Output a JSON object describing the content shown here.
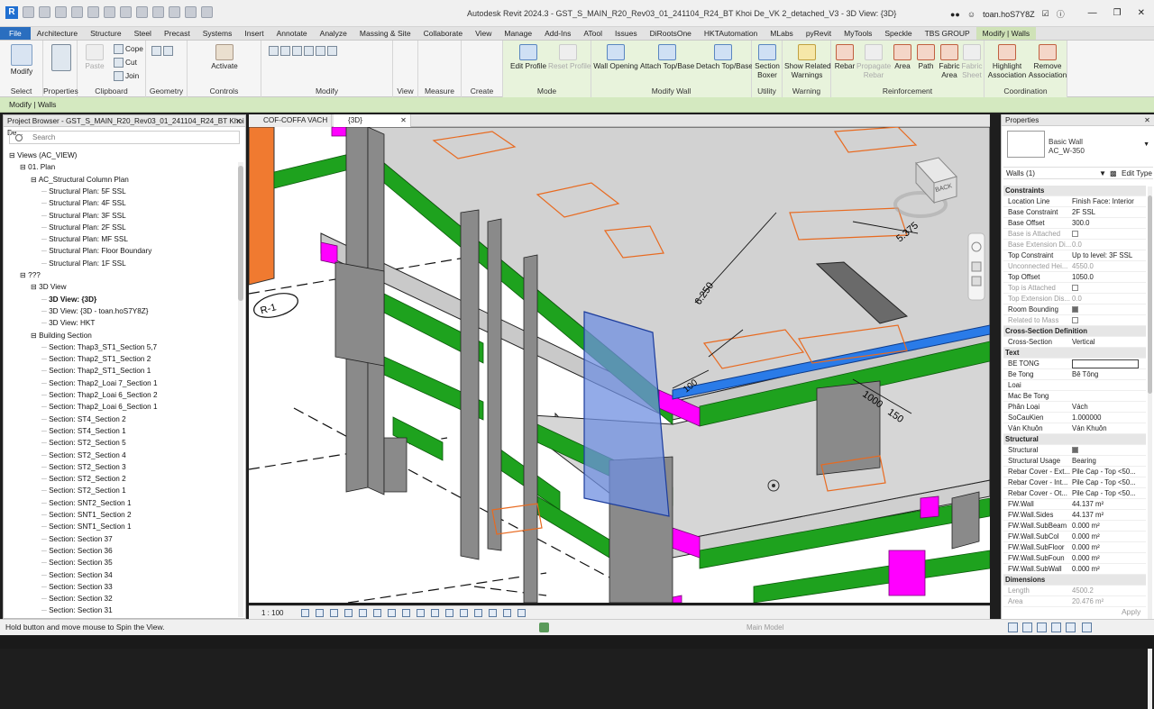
{
  "window": {
    "title": "Autodesk Revit 2024.3 - GST_S_MAIN_R20_Rev03_01_241104_R24_BT Khoi De_VK 2_detached_V3 - 3D View: {3D}",
    "user": "toan.hoS7Y8Z",
    "logo": "R"
  },
  "tabs": [
    "File",
    "Architecture",
    "Structure",
    "Steel",
    "Precast",
    "Systems",
    "Insert",
    "Annotate",
    "Analyze",
    "Massing & Site",
    "Collaborate",
    "View",
    "Manage",
    "Add-Ins",
    "ATool",
    "Issues",
    "DiRootsOne",
    "HKTAutomation",
    "MLabs",
    "pyRevit",
    "MyTools",
    "Speckle",
    "TBS GROUP",
    "Modify | Walls"
  ],
  "ribbon": {
    "select": {
      "modify": "Modify",
      "label": "Select"
    },
    "properties": {
      "label": "Properties"
    },
    "clipboard": {
      "paste": "Paste",
      "cope": "Cope",
      "cut": "Cut",
      "join": "Join",
      "label": "Clipboard"
    },
    "geometry": {
      "label": "Geometry"
    },
    "controls": {
      "activate": "Activate",
      "label": "Controls"
    },
    "modify": {
      "label": "Modify"
    },
    "view": {
      "label": "View"
    },
    "measure": {
      "label": "Measure"
    },
    "create": {
      "label": "Create"
    },
    "mode": {
      "edit_profile": "Edit Profile",
      "reset_profile": "Reset Profile",
      "label": "Mode"
    },
    "modify_wall": {
      "wall_opening": "Wall Opening",
      "attach": "Attach Top/Base",
      "detach": "Detach Top/Base",
      "label": "Modify Wall"
    },
    "utility": {
      "section_boxer_1": "Section",
      "section_boxer_2": "Boxer",
      "label": "Utility"
    },
    "warning": {
      "show_1": "Show Related",
      "show_2": "Warnings",
      "label": "Warning"
    },
    "reinforcement": {
      "rebar": "Rebar",
      "propagate_1": "Propagate",
      "propagate_2": "Rebar",
      "area": "Area",
      "path": "Path",
      "fabric_1": "Fabric",
      "fabric_2": "Area",
      "fabric_sheet_1": "Fabric",
      "fabric_sheet_2": "Sheet",
      "label": "Reinforcement"
    },
    "coordination": {
      "highlight_1": "Highlight",
      "highlight_2": "Association",
      "remove_1": "Remove",
      "remove_2": "Association",
      "label": "Coordination"
    }
  },
  "context": "Modify | Walls",
  "project_browser": {
    "title": "Project Browser - GST_S_MAIN_R20_Rev03_01_241104_R24_BT Khoi De...",
    "search_placeholder": "Search",
    "items": [
      {
        "text": "Views (AC_VIEW)",
        "level": 0,
        "exp": "-"
      },
      {
        "text": "01. Plan",
        "level": 1,
        "exp": "-"
      },
      {
        "text": "AC_Structural Column Plan",
        "level": 2,
        "exp": "-"
      },
      {
        "text": "Structural Plan: 5F SSL",
        "level": 3
      },
      {
        "text": "Structural Plan: 4F SSL",
        "level": 3
      },
      {
        "text": "Structural Plan: 3F SSL",
        "level": 3
      },
      {
        "text": "Structural Plan: 2F SSL",
        "level": 3
      },
      {
        "text": "Structural Plan: MF SSL",
        "level": 3
      },
      {
        "text": "Structural Plan: Floor Boundary",
        "level": 3
      },
      {
        "text": "Structural Plan: 1F SSL",
        "level": 3
      },
      {
        "text": "???",
        "level": 1,
        "exp": "-"
      },
      {
        "text": "3D View",
        "level": 2,
        "exp": "-"
      },
      {
        "text": "3D View: {3D}",
        "level": 3,
        "bold": true
      },
      {
        "text": "3D View: {3D - toan.hoS7Y8Z}",
        "level": 3
      },
      {
        "text": "3D View: HKT",
        "level": 3
      },
      {
        "text": "Building Section",
        "level": 2,
        "exp": "-"
      },
      {
        "text": "Section: Thap3_ST1_Section 5,7",
        "level": 3
      },
      {
        "text": "Section: Thap2_ST1_Section 2",
        "level": 3
      },
      {
        "text": "Section: Thap2_ST1_Section 1",
        "level": 3
      },
      {
        "text": "Section: Thap2_Loai 7_Section 1",
        "level": 3
      },
      {
        "text": "Section: Thap2_Loai 6_Section 2",
        "level": 3
      },
      {
        "text": "Section: Thap2_Loai 6_Section 1",
        "level": 3
      },
      {
        "text": "Section: ST4_Section 2",
        "level": 3
      },
      {
        "text": "Section: ST4_Section 1",
        "level": 3
      },
      {
        "text": "Section: ST2_Section 5",
        "level": 3
      },
      {
        "text": "Section: ST2_Section 4",
        "level": 3
      },
      {
        "text": "Section: ST2_Section 3",
        "level": 3
      },
      {
        "text": "Section: ST2_Section 2",
        "level": 3
      },
      {
        "text": "Section: ST2_Section 1",
        "level": 3
      },
      {
        "text": "Section: SNT2_Section 1",
        "level": 3
      },
      {
        "text": "Section: SNT1_Section 2",
        "level": 3
      },
      {
        "text": "Section: SNT1_Section 1",
        "level": 3
      },
      {
        "text": "Section: Section 37",
        "level": 3
      },
      {
        "text": "Section: Section 36",
        "level": 3
      },
      {
        "text": "Section: Section 35",
        "level": 3
      },
      {
        "text": "Section: Section 34",
        "level": 3
      },
      {
        "text": "Section: Section 33",
        "level": 3
      },
      {
        "text": "Section: Section 32",
        "level": 3
      },
      {
        "text": "Section: Section 31",
        "level": 3
      }
    ]
  },
  "view_tabs": [
    {
      "label": "COF-COFFA VACH"
    },
    {
      "label": "{3D}"
    }
  ],
  "canvas": {
    "dims": [
      "5.375",
      "6.250",
      "1000",
      "150",
      "100"
    ],
    "grid_bubble": "R-1",
    "viewcube_face": "BACK"
  },
  "view_control": {
    "scale": "1 : 100"
  },
  "properties": {
    "title": "Properties",
    "type_name": "Basic Wall",
    "type_sub": "AC_W-350",
    "instance": "Walls (1)",
    "edit_type": "Edit Type",
    "rows": [
      {
        "cat": "Constraints"
      },
      {
        "k": "Location Line",
        "v": "Finish Face: Interior"
      },
      {
        "k": "Base Constraint",
        "v": "2F SSL"
      },
      {
        "k": "Base Offset",
        "v": "300.0"
      },
      {
        "k": "Base is Attached",
        "v": "",
        "cb": "off",
        "dim": true
      },
      {
        "k": "Base Extension Di...",
        "v": "0.0",
        "dim": true
      },
      {
        "k": "Top Constraint",
        "v": "Up to level: 3F SSL"
      },
      {
        "k": "Unconnected Hei...",
        "v": "4550.0",
        "dim": true
      },
      {
        "k": "Top Offset",
        "v": "1050.0"
      },
      {
        "k": "Top is Attached",
        "v": "",
        "cb": "off",
        "dim": true
      },
      {
        "k": "Top Extension Dis...",
        "v": "0.0",
        "dim": true
      },
      {
        "k": "Room Bounding",
        "v": "",
        "cb": "on"
      },
      {
        "k": "Related to Mass",
        "v": "",
        "cb": "off",
        "dim": true
      },
      {
        "cat": "Cross-Section Definition"
      },
      {
        "k": "Cross-Section",
        "v": "Vertical"
      },
      {
        "cat": "Text"
      },
      {
        "k": "BE TONG",
        "v": "",
        "box": true
      },
      {
        "k": "Be Tong",
        "v": "Bê Tông"
      },
      {
        "k": "Loai",
        "v": ""
      },
      {
        "k": "Mac Be Tong",
        "v": ""
      },
      {
        "k": "Phân Loại",
        "v": "Vách"
      },
      {
        "k": "SoCauKien",
        "v": "1.000000"
      },
      {
        "k": "Ván Khuôn",
        "v": "Ván Khuôn"
      },
      {
        "cat": "Structural"
      },
      {
        "k": "Structural",
        "v": "",
        "cb": "on"
      },
      {
        "k": "Structural Usage",
        "v": "Bearing"
      },
      {
        "k": "Rebar Cover - Ext...",
        "v": "Pile Cap - Top <50..."
      },
      {
        "k": "Rebar Cover - Int...",
        "v": "Pile Cap - Top <50..."
      },
      {
        "k": "Rebar Cover - Ot...",
        "v": "Pile Cap - Top <50..."
      },
      {
        "k": "FW.Wall",
        "v": "44.137 m²"
      },
      {
        "k": "FW.Wall.Sides",
        "v": "44.137 m²"
      },
      {
        "k": "FW.Wall.SubBeam",
        "v": "0.000 m²"
      },
      {
        "k": "FW.Wall.SubCol",
        "v": "0.000 m²"
      },
      {
        "k": "FW.Wall.SubFloor",
        "v": "0.000 m²"
      },
      {
        "k": "FW.Wall.SubFoun",
        "v": "0.000 m²"
      },
      {
        "k": "FW.Wall.SubWall",
        "v": "0.000 m²"
      },
      {
        "cat": "Dimensions"
      },
      {
        "k": "Length",
        "v": "4500.2",
        "dim": true
      },
      {
        "k": "Area",
        "v": "20.476 m²",
        "dim": true
      }
    ],
    "apply": "Apply"
  },
  "status": {
    "text": "Hold button and move mouse to Spin the View.",
    "model": "Main Model"
  },
  "colors": {
    "green": "#1ea21e",
    "magenta": "#ff00ff",
    "blue": "#2a7be8",
    "orange": "#f07a30",
    "selected": "#6f8fe0"
  }
}
